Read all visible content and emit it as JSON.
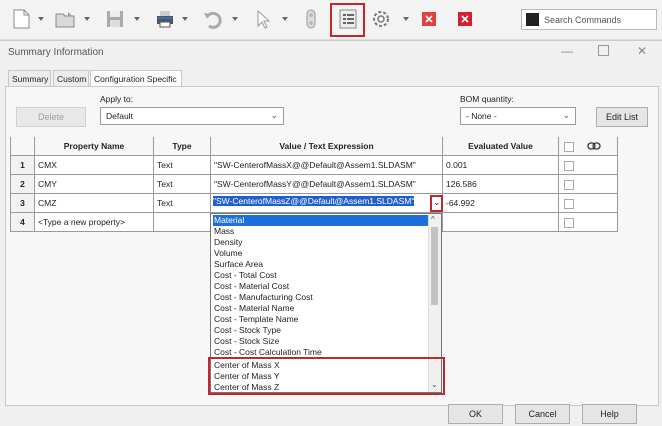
{
  "toolbar": {
    "search_placeholder": "Search Commands"
  },
  "dialog": {
    "title": "Summary Information",
    "tabs": [
      "Summary",
      "Custom",
      "Configuration Specific"
    ],
    "delete_label": "Delete",
    "apply_to_label": "Apply to:",
    "apply_to_value": "Default",
    "bom_label": "BOM quantity:",
    "bom_value": "- None -",
    "edit_list_label": "Edit List",
    "ok_label": "OK",
    "cancel_label": "Cancel",
    "help_label": "Help"
  },
  "table": {
    "headers": [
      "Property Name",
      "Type",
      "Value / Text Expression",
      "Evaluated Value"
    ],
    "rows": [
      {
        "num": "1",
        "name": "CMX",
        "type": "Text",
        "value": "\"SW-CenterofMassX@@Default@Assem1.SLDASM\"",
        "evaluated": "0.001"
      },
      {
        "num": "2",
        "name": "CMY",
        "type": "Text",
        "value": "\"SW-CenterofMassY@@Default@Assem1.SLDASM\"",
        "evaluated": "126.586"
      },
      {
        "num": "3",
        "name": "CMZ",
        "type": "Text",
        "value": "\"SW-CenterofMassZ@@Default@Assem1.SLDASM\"",
        "evaluated": "-64.992"
      },
      {
        "num": "4",
        "name": "<Type a new property>",
        "type": "",
        "value": "",
        "evaluated": ""
      }
    ]
  },
  "dropdown": {
    "items": [
      "Material",
      "Mass",
      "Density",
      "Volume",
      "Surface Area",
      "Cost - Total Cost",
      "Cost - Material Cost",
      "Cost - Manufacturing Cost",
      "Cost - Material Name",
      "Cost - Template Name",
      "Cost - Stock Type",
      "Cost - Stock Size",
      "Cost - Cost Calculation Time",
      "Center of Mass X",
      "Center of Mass Y",
      "Center of Mass Z"
    ],
    "selected_index": 0
  },
  "accent_color": "#c0282d",
  "selection_color": "#1e6fd9",
  "icons": [
    "new-document-icon",
    "open-folder-icon",
    "save-icon",
    "print-icon",
    "undo-icon",
    "select-cursor-icon",
    "rebuild-traffic-light-icon",
    "file-properties-icon",
    "options-gear-icon",
    "close-red-icon",
    "exit-red-icon",
    "search-icon",
    "link-icon"
  ]
}
